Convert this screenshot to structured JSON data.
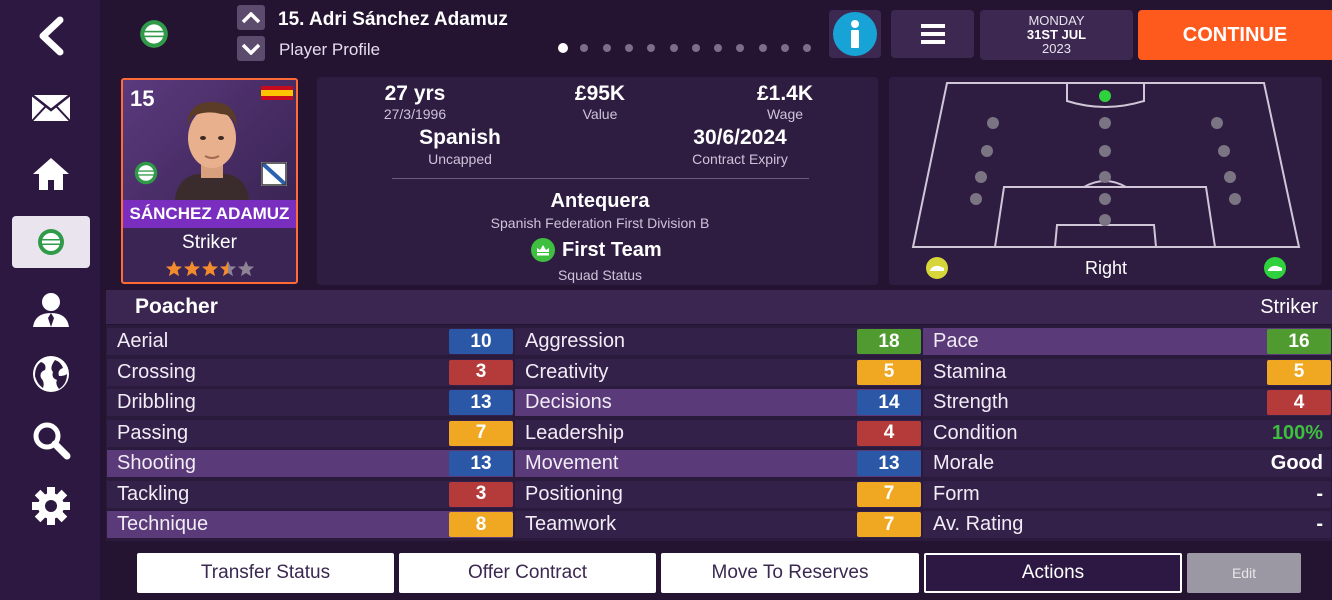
{
  "header": {
    "title": "15. Adri Sánchez Adamuz",
    "subtitle": "Player Profile",
    "date_day": "MONDAY",
    "date_date": "31ST JUL",
    "date_year": "2023",
    "continue_label": "CONTINUE",
    "page_dots": 12,
    "active_dot": 0
  },
  "sidebar": {
    "items": [
      "back-icon",
      "mail-icon",
      "home-icon",
      "club-badge-icon",
      "person-icon",
      "globe-icon",
      "search-icon",
      "gear-icon"
    ],
    "active": "club-badge-icon"
  },
  "player_card": {
    "number": "15",
    "name": "SÁNCHEZ ADAMUZ",
    "position": "Striker",
    "stars": 3.5,
    "max_stars": 5,
    "nationality_flag": "spain-flag"
  },
  "info": {
    "age": "27 yrs",
    "dob": "27/3/1996",
    "value": "£95K",
    "value_label": "Value",
    "wage": "£1.4K",
    "wage_label": "Wage",
    "nationality": "Spanish",
    "caps": "Uncapped",
    "contract": "30/6/2024",
    "contract_label": "Contract Expiry",
    "club": "Antequera",
    "league": "Spanish Federation First Division B",
    "squad_status": "First Team",
    "squad_status_label": "Squad Status"
  },
  "pitch": {
    "foot_label": "Right"
  },
  "role_bar": {
    "role": "Poacher",
    "position": "Striker"
  },
  "attributes": {
    "technical": [
      {
        "name": "Aerial",
        "value": "10",
        "color": "blue",
        "hl": false
      },
      {
        "name": "Crossing",
        "value": "3",
        "color": "red",
        "hl": false
      },
      {
        "name": "Dribbling",
        "value": "13",
        "color": "blue",
        "hl": false
      },
      {
        "name": "Passing",
        "value": "7",
        "color": "yellow",
        "hl": false
      },
      {
        "name": "Shooting",
        "value": "13",
        "color": "blue",
        "hl": true
      },
      {
        "name": "Tackling",
        "value": "3",
        "color": "red",
        "hl": false
      },
      {
        "name": "Technique",
        "value": "8",
        "color": "yellow",
        "hl": true
      }
    ],
    "mental": [
      {
        "name": "Aggression",
        "value": "18",
        "color": "green",
        "hl": false
      },
      {
        "name": "Creativity",
        "value": "5",
        "color": "yellow",
        "hl": false
      },
      {
        "name": "Decisions",
        "value": "14",
        "color": "blue",
        "hl": true
      },
      {
        "name": "Leadership",
        "value": "4",
        "color": "red",
        "hl": false
      },
      {
        "name": "Movement",
        "value": "13",
        "color": "blue",
        "hl": true
      },
      {
        "name": "Positioning",
        "value": "7",
        "color": "yellow",
        "hl": false
      },
      {
        "name": "Teamwork",
        "value": "7",
        "color": "yellow",
        "hl": false
      }
    ],
    "physical": [
      {
        "name": "Pace",
        "value": "16",
        "color": "green",
        "hl": true
      },
      {
        "name": "Stamina",
        "value": "5",
        "color": "yellow",
        "hl": false
      },
      {
        "name": "Strength",
        "value": "4",
        "color": "red",
        "hl": false
      },
      {
        "name": "Condition",
        "value": "100%",
        "color": "text-green",
        "hl": false
      },
      {
        "name": "Morale",
        "value": "Good",
        "color": "text-white",
        "hl": false
      },
      {
        "name": "Form",
        "value": "-",
        "color": "text-white",
        "hl": false
      },
      {
        "name": "Av. Rating",
        "value": "-",
        "color": "text-white",
        "hl": false
      }
    ]
  },
  "footer": {
    "transfer_status": "Transfer Status",
    "offer_contract": "Offer Contract",
    "move_reserves": "Move To Reserves",
    "actions": "Actions",
    "edit": "Edit"
  },
  "colors": {
    "accent": "#ff5a1e",
    "info_blue": "#18a3d6",
    "blue": "#2a57a6",
    "red": "#b53a3a",
    "yellow": "#f0a822",
    "green": "#4f9b2f",
    "highlight_green": "#3fbf3f"
  }
}
